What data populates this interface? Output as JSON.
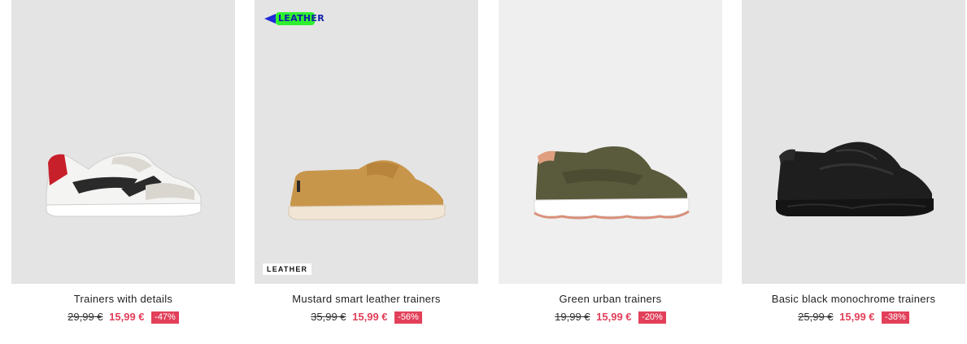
{
  "products": [
    {
      "title": "Trainers with details",
      "old_price": "29,99 €",
      "new_price": "15,99 €",
      "discount": "-47%",
      "image_icon": "white-trainer-icon"
    },
    {
      "title": "Mustard smart leather trainers",
      "old_price": "35,99 €",
      "new_price": "15,99 €",
      "discount": "-56%",
      "tag": "LEATHER",
      "sticker": "LEATHER",
      "image_icon": "mustard-shoe-icon"
    },
    {
      "title": "Green urban trainers",
      "old_price": "19,99 €",
      "new_price": "15,99 €",
      "discount": "-20%",
      "image_icon": "green-trainer-icon"
    },
    {
      "title": "Basic black monochrome trainers",
      "old_price": "25,99 €",
      "new_price": "15,99 €",
      "discount": "-38%",
      "image_icon": "black-trainer-icon"
    }
  ],
  "colors": {
    "sale_red": "#e2405a",
    "image_bg": "#e4e4e4",
    "sticker_green": "#2ef02e",
    "sticker_blue": "#1c2bd6"
  }
}
